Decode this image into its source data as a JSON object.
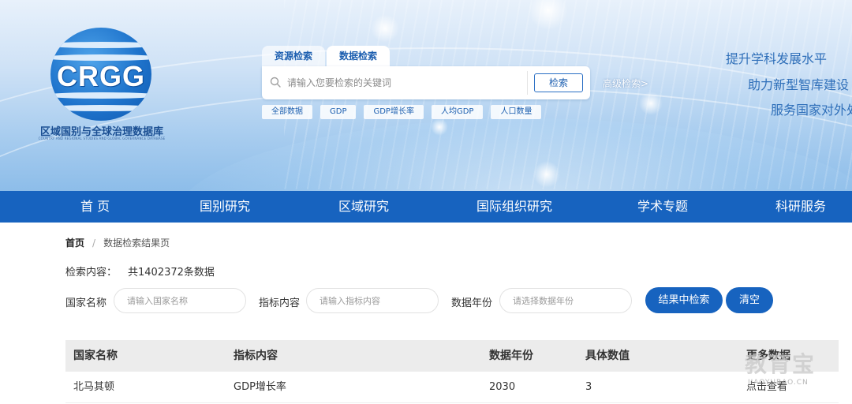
{
  "logo": {
    "mark_text": "CRGG",
    "cn_name": "区域国别与全球治理数据库",
    "en_name": "COUNTRY AND REGIONAL STUDIES AND GLOBAL GOVERNANCE DATABASE"
  },
  "search": {
    "tabs": [
      {
        "label": "资源检索",
        "active": false
      },
      {
        "label": "数据检索",
        "active": true
      }
    ],
    "placeholder": "请输入您要检索的关键词",
    "button_label": "检索",
    "advanced_label": "高级检索>",
    "tags": [
      "全部数据",
      "GDP",
      "GDP增长率",
      "人均GDP",
      "人口数量"
    ]
  },
  "slogans": [
    "提升学科发展水平",
    "助力新型智库建设",
    "服务国家对外处"
  ],
  "nav": [
    "首 页",
    "国别研究",
    "区域研究",
    "国际组织研究",
    "学术专题",
    "科研服务"
  ],
  "breadcrumb": {
    "home": "首页",
    "separator": "/",
    "current": "数据检索结果页"
  },
  "summary": {
    "label": "检索内容：",
    "count_text": "共1402372条数据"
  },
  "filters": {
    "country_label": "国家名称",
    "country_placeholder": "请输入国家名称",
    "indicator_label": "指标内容",
    "indicator_placeholder": "请输入指标内容",
    "year_label": "数据年份",
    "year_placeholder": "请选择数据年份",
    "search_in_results": "结果中检索",
    "clear": "清空"
  },
  "table": {
    "headers": [
      "国家名称",
      "指标内容",
      "数据年份",
      "具体数值",
      "更多数据"
    ],
    "rows": [
      [
        "北马其顿",
        "GDP增长率",
        "2030",
        "3",
        "点击查看"
      ]
    ]
  },
  "watermark": {
    "big": "教育宝",
    "small": "JIAOYUBAO.CN"
  },
  "colors": {
    "nav_bg": "#1763bf",
    "accent": "#1d5fb0",
    "banner_light": "#e8f1fb"
  }
}
